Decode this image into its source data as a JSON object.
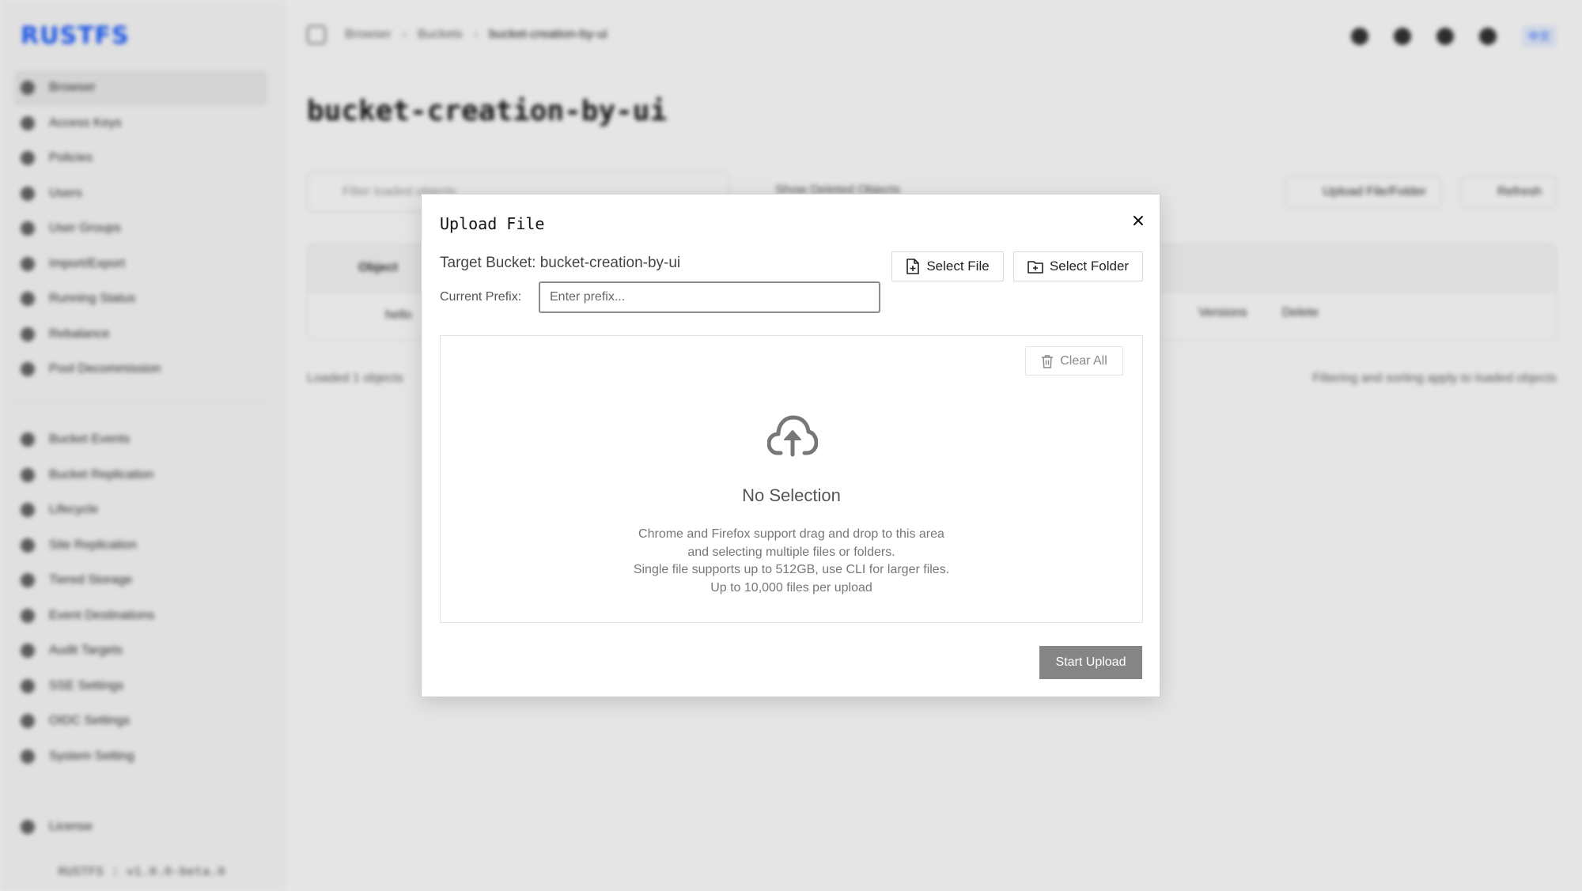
{
  "app": {
    "logo": "RUSTFS",
    "version": "RUSTFS : v1.0.0-beta.0",
    "sidebar": {
      "primary": [
        {
          "label": "Browser",
          "icon": "folder-icon",
          "active": true
        },
        {
          "label": "Access Keys",
          "icon": "key-icon"
        },
        {
          "label": "Policies",
          "icon": "policy-icon"
        },
        {
          "label": "Users",
          "icon": "user-icon"
        },
        {
          "label": "User Groups",
          "icon": "group-icon"
        },
        {
          "label": "Import/Export",
          "icon": "import-export-icon"
        },
        {
          "label": "Running Status",
          "icon": "status-icon"
        },
        {
          "label": "Rebalance",
          "icon": "rebalance-icon"
        },
        {
          "label": "Pool Decommission",
          "icon": "pool-icon"
        }
      ],
      "secondary": [
        {
          "label": "Bucket Events",
          "icon": "events-icon"
        },
        {
          "label": "Bucket Replication",
          "icon": "replication-icon"
        },
        {
          "label": "Lifecycle",
          "icon": "lifecycle-icon"
        },
        {
          "label": "Site Replication",
          "icon": "site-replication-icon"
        },
        {
          "label": "Tiered Storage",
          "icon": "tiered-storage-icon"
        },
        {
          "label": "Event Destinations",
          "icon": "destinations-icon"
        },
        {
          "label": "Audit Targets",
          "icon": "audit-icon"
        },
        {
          "label": "SSE Settings",
          "icon": "sse-icon"
        },
        {
          "label": "OIDC Settings",
          "icon": "oidc-icon"
        },
        {
          "label": "System Setting",
          "icon": "settings-icon"
        }
      ],
      "bottom": [
        {
          "label": "License",
          "icon": "license-icon"
        }
      ]
    },
    "breadcrumb": [
      "Browser",
      "Buckets",
      "bucket-creation-by-ui"
    ],
    "lang": "中文",
    "page_title": "bucket-creation-by-ui",
    "filter_placeholder": "Filter loaded objects",
    "show_deleted": "Show Deleted Objects",
    "upload_button": "Upload File/Folder",
    "refresh_button": "Refresh",
    "table": {
      "column_object": "Object",
      "row_name": "hello",
      "row_action_versions": "Versions",
      "row_action_delete": "Delete"
    },
    "footer_left": "Loaded 1 objects",
    "footer_right": "Filtering and sorting apply to loaded objects"
  },
  "modal": {
    "title": "Upload File",
    "target_bucket": "Target Bucket: bucket-creation-by-ui",
    "select_file": "Select File",
    "select_folder": "Select Folder",
    "prefix_label": "Current Prefix:",
    "prefix_placeholder": "Enter prefix...",
    "prefix_value": "",
    "clear_all": "Clear All",
    "empty_title": "No Selection",
    "hint_lines": [
      "Chrome and Firefox support drag and drop to this area",
      "and selecting multiple files or folders.",
      "Single file supports up to 512GB, use CLI for larger files.",
      "Up to 10,000 files per upload"
    ],
    "start_upload": "Start Upload"
  }
}
